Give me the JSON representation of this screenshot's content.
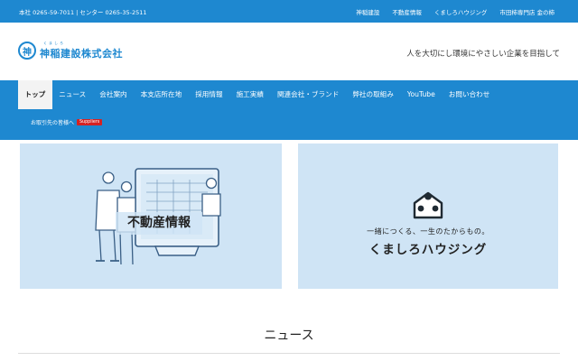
{
  "topbar": {
    "contact": "本社 0265-59-7011 | センター 0265-35-2511",
    "links": [
      "神稲建設",
      "不動産情報",
      "くましろハウジング",
      "市田柿専門店 金の柿"
    ]
  },
  "header": {
    "logo_mark": "神",
    "logo_ruby": "くましろ",
    "logo_name": "神稲建設株式会社",
    "tagline": "人を大切にし環境にやさしい企業を目指して"
  },
  "nav": {
    "items": [
      "トップ",
      "ニュース",
      "会社案内",
      "本支店所在地",
      "採用情報",
      "施工実績",
      "関連会社・ブランド",
      "弊社の取組み",
      "YouTube",
      "お問い合わせ"
    ],
    "active_index": 0,
    "sub_label": "お取引先の皆様へ",
    "sub_badge": "Suppliers"
  },
  "banners": {
    "real_estate_title": "不動産情報",
    "kumashiro_tagline": "一緒につくる、一生のたからもの。",
    "kumashiro_name": "くましろハウジング"
  },
  "news": {
    "heading": "ニュース"
  },
  "colors": {
    "brand_blue": "#1e88d0",
    "banner_bg": "#cfe4f5",
    "badge_red": "#d52222",
    "news_category": "#e86a2a"
  }
}
